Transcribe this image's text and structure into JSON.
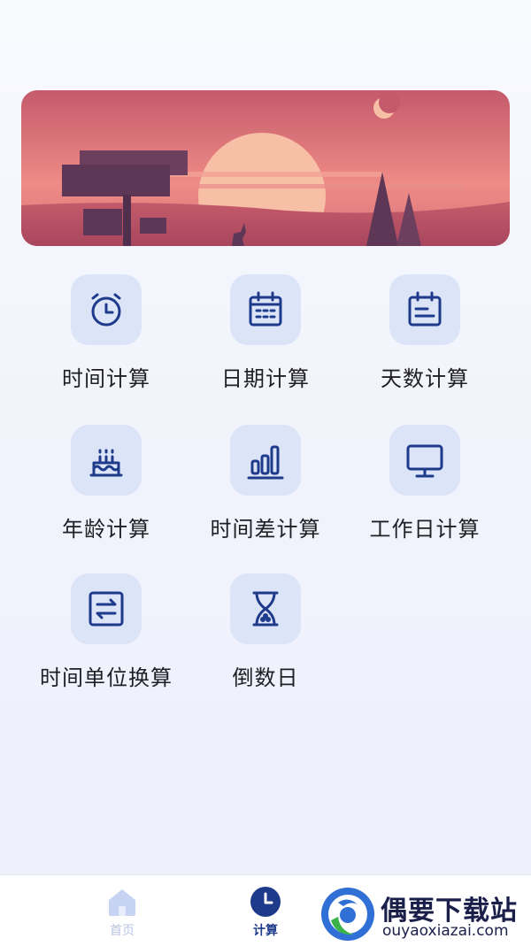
{
  "grid": {
    "items": [
      {
        "label": "时间计算",
        "icon": "alarm-clock-icon"
      },
      {
        "label": "日期计算",
        "icon": "calendar-icon"
      },
      {
        "label": "天数计算",
        "icon": "calendar-days-icon"
      },
      {
        "label": "年龄计算",
        "icon": "birthday-cake-icon"
      },
      {
        "label": "时间差计算",
        "icon": "bar-chart-icon"
      },
      {
        "label": "工作日计算",
        "icon": "monitor-icon"
      },
      {
        "label": "时间单位换算",
        "icon": "convert-arrows-icon"
      },
      {
        "label": "倒数日",
        "icon": "hourglass-icon"
      }
    ]
  },
  "tabbar": {
    "tabs": [
      {
        "label": "首页",
        "icon": "home-icon",
        "active": false
      },
      {
        "label": "计算",
        "icon": "clock-icon",
        "active": true
      }
    ]
  },
  "watermark": {
    "brand": "偶要下载站",
    "domain": "ouyaoxiazai.com"
  },
  "colors": {
    "accent": "#1e3a8a",
    "tile_bg": "#dce4f8",
    "tab_inactive": "#b9c4e6",
    "banner_sunset": "#e07a7e"
  }
}
